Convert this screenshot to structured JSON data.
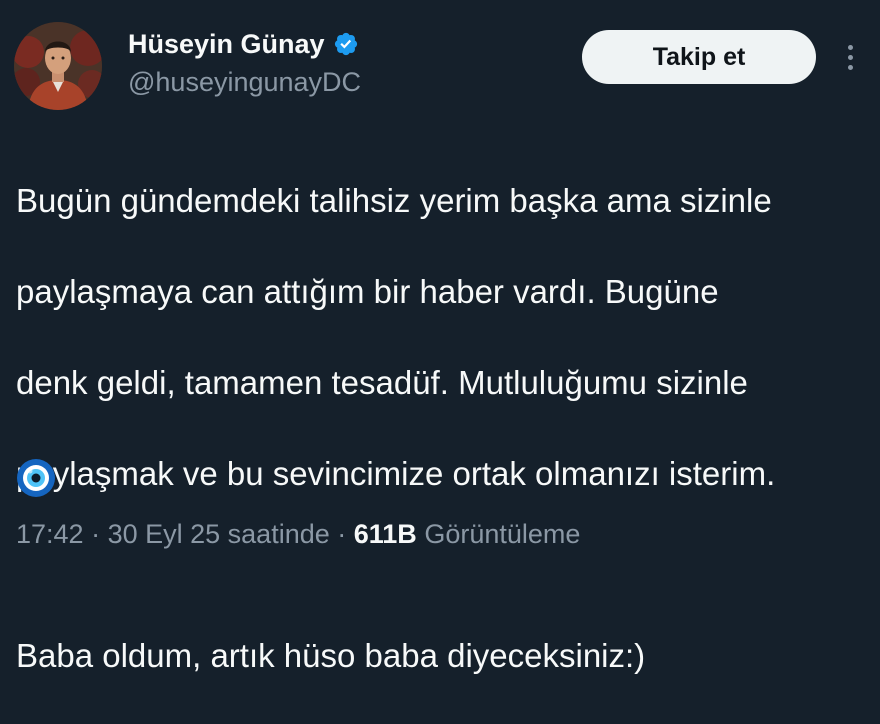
{
  "author": {
    "display_name": "Hüseyin Günay",
    "handle": "@huseyingunayDC",
    "verified": true
  },
  "actions": {
    "follow_label": "Takip et",
    "more_icon": "more-vertical-icon"
  },
  "tweet": {
    "lines": [
      "Bugün gündemdeki talihsiz yerim başka ama sizinle",
      "paylaşmaya can attığım bir haber vardı. Bugüne",
      "denk geldi, tamamen tesadüf. Mutluluğumu sizinle",
      "paylaşmak ve bu sevincimize ortak olmanızı isterim."
    ],
    "second_paragraph": "Baba oldum, artık hüso baba diyeceksiniz:)",
    "emoji": "nazar-boncugu-icon"
  },
  "meta": {
    "time": "17:42",
    "sep1": " · ",
    "date": "30 Eyl 25",
    "time_suffix": " saatinde",
    "sep2": " · ",
    "views_count": "611B",
    "views_label": " Görüntüleme"
  },
  "colors": {
    "background": "#15202b",
    "verified_blue": "#1d9bf0",
    "secondary_text": "#8b98a5",
    "primary_text": "#f7f9f9"
  }
}
